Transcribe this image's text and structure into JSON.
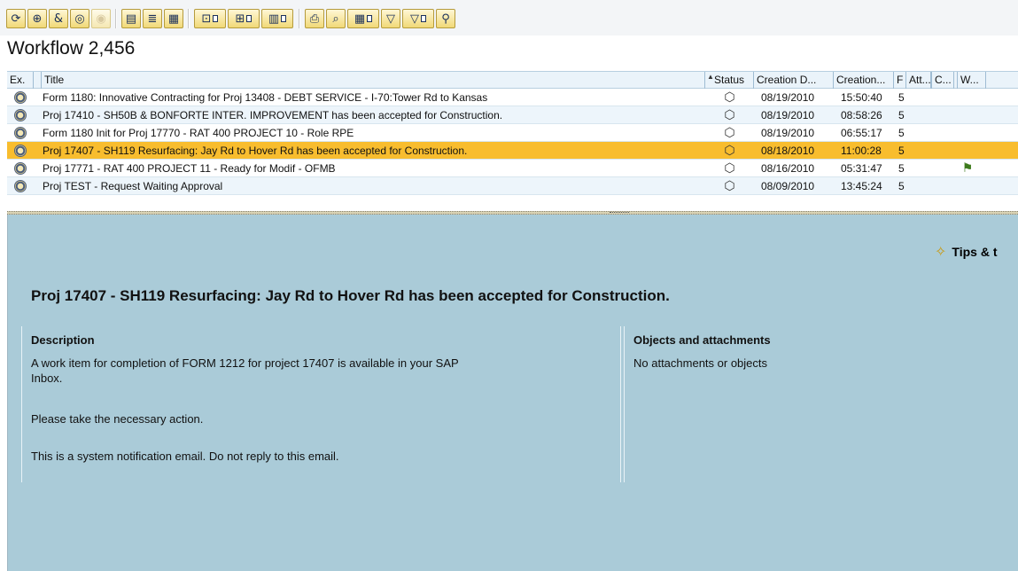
{
  "toolbar": {
    "buttons": [
      "refresh-icon",
      "execute-icon",
      "forward-icon",
      "display-icon",
      "disabled-icon",
      "filter-icon",
      "sort-icon",
      "layout-icon",
      "attachment-icon",
      "new-document-icon",
      "overview-icon",
      "print-icon",
      "zoom-icon",
      "columns-icon",
      "filter-set-icon",
      "filter-reset-icon",
      "find-icon"
    ]
  },
  "workflow_title": "Workflow 2,456",
  "table": {
    "headers": {
      "ex": "Ex.",
      "title": "Title",
      "status": "Status",
      "creation_date": "Creation D...",
      "creation_time": "Creation...",
      "f": "F",
      "att": "Att...",
      "c": "C...",
      "w": "W..."
    },
    "rows": [
      {
        "title": "Form 1180:  Innovative Contracting for Proj 13408 - DEBT SERVICE - I-70:Tower Rd  to Kansas",
        "status_icon": "new-item-icon",
        "date": "08/19/2010",
        "time": "15:50:40",
        "f": "5",
        "flag": ""
      },
      {
        "title": "Proj 17410 - SH50B & BONFORTE INTER. IMPROVEMENT has been accepted for Construction.",
        "status_icon": "new-item-icon",
        "date": "08/19/2010",
        "time": "08:58:26",
        "f": "5",
        "flag": ""
      },
      {
        "title": "Form 1180 Init for Proj 17770 - RAT 400 PROJECT 10 - Role RPE",
        "status_icon": "new-item-icon",
        "date": "08/19/2010",
        "time": "06:55:17",
        "f": "5",
        "flag": ""
      },
      {
        "title": "Proj 17407 - SH119 Resurfacing: Jay Rd to Hover Rd has been accepted for Construction.",
        "status_icon": "new-item-icon",
        "date": "08/18/2010",
        "time": "11:00:28",
        "f": "5",
        "flag": ""
      },
      {
        "title": "Proj 17771 - RAT 400 PROJECT 11 - Ready for Modif - OFMB",
        "status_icon": "new-item-icon",
        "date": "08/16/2010",
        "time": "05:31:47",
        "f": "5",
        "flag": "flag-icon"
      },
      {
        "title": "Proj TEST - Request Waiting Approval",
        "status_icon": "new-item-icon",
        "date": "08/09/2010",
        "time": "13:45:24",
        "f": "5",
        "flag": ""
      }
    ],
    "selected_index": 3
  },
  "preview": {
    "tips": "Tips & t",
    "subject": "Proj 17407 - SH119 Resurfacing: Jay Rd to Hover Rd has been accepted for Construction.",
    "description_heading": "Description",
    "description_line1": "A work item for completion of FORM 1212 for project 17407 is available in your SAP",
    "description_line1b": "Inbox.",
    "description_line2": "Please take the necessary action.",
    "description_line3": "This is a system notification email. Do not reply to this email.",
    "objects_heading": "Objects and attachments",
    "objects_text": "No attachments or objects"
  },
  "colors": {
    "selected_row": "#f8bd2e",
    "preview_bg": "#aacbd8",
    "header_bg": "#eaf3fa"
  }
}
